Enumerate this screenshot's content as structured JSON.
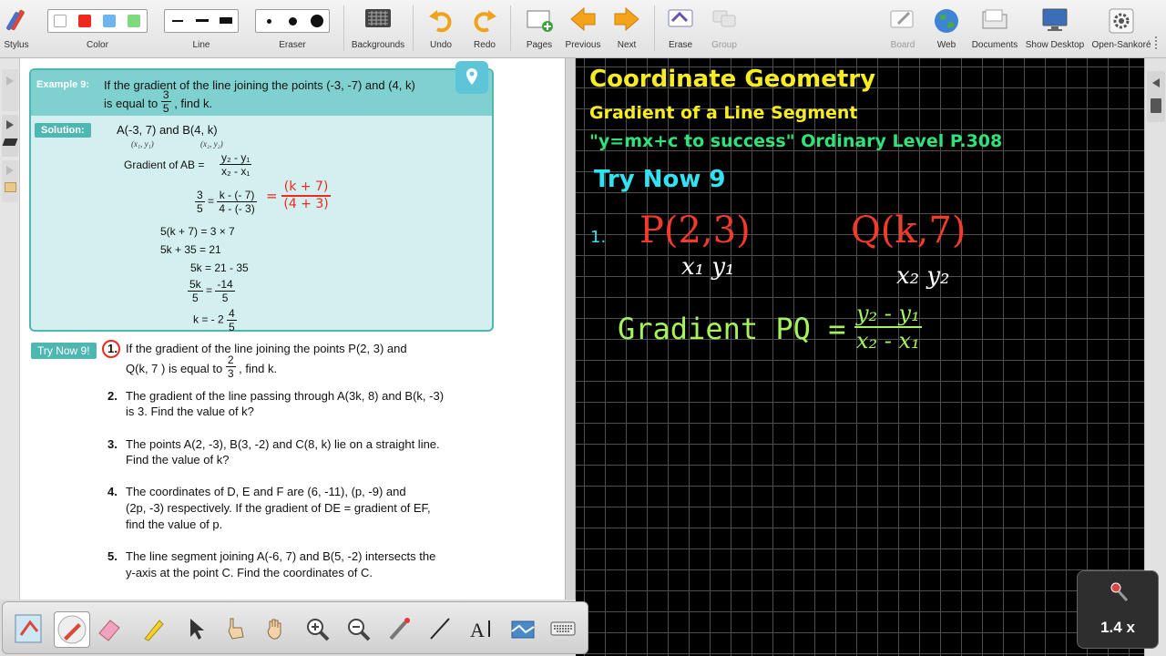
{
  "toolbar": {
    "stylus": "Stylus",
    "color": "Color",
    "line": "Line",
    "eraser": "Eraser",
    "backgrounds": "Backgrounds",
    "undo": "Undo",
    "redo": "Redo",
    "pages": "Pages",
    "previous": "Previous",
    "next": "Next",
    "erase": "Erase",
    "group": "Group",
    "board": "Board",
    "web": "Web",
    "documents": "Documents",
    "show_desktop": "Show Desktop",
    "open_sankore": "Open-Sankoré",
    "swatch_colors": [
      "#ffffff",
      "#ee2a1f",
      "#6fb6ee",
      "#7fd97f"
    ]
  },
  "book": {
    "example_tag": "Example 9:",
    "example_q1": "If the gradient of the line joining the points (-3, -7) and (4, k)",
    "example_q2a": "is equal to",
    "example_frac_n": "3",
    "example_frac_d": "5",
    "example_q2b": ", find k.",
    "solution_tag": "Solution:",
    "points": "A(-3, 7) and B(4, k)",
    "sub1": "(x₁, y₁)",
    "sub2": "(x₂, y₂)",
    "grad_label": "Gradient of AB =",
    "grad_n": "y₂ - y₁",
    "grad_d": "x₂ - x₁",
    "step1_l_n": "3",
    "step1_l_d": "5",
    "step1_eq": "=",
    "step1_r_n": "k - (- 7)",
    "step1_r_d": "4 - (- 3)",
    "step2": "5(k + 7) = 3 × 7",
    "step3": "5k + 35 = 21",
    "step4": "5k = 21 - 35",
    "step5_l_n": "5k",
    "step5_l_d": "5",
    "step5_eq": "=",
    "step5_r_n": "-14",
    "step5_r_d": "5",
    "step6a": "k = - 2",
    "step6_n": "4",
    "step6_d": "5",
    "try_tag": "Try Now 9!",
    "red_eq": "=",
    "red_n": "(k + 7)",
    "red_d": "(4 + 3)",
    "items": [
      {
        "no": "1.",
        "l1": "If the gradient of the line joining the points P(2, 3) and",
        "l2a": "Q(k, 7 ) is equal to",
        "fn": "2",
        "fd": "3",
        "l2b": ", find k."
      },
      {
        "no": "2.",
        "l1": "The gradient of the line passing through A(3k, 8) and B(k, -3)",
        "l2": "is 3.  Find the value of k?"
      },
      {
        "no": "3.",
        "l1": "The points A(2, -3), B(3, -2) and C(8, k) lie on a straight line.",
        "l2": "Find the value of k?"
      },
      {
        "no": "4.",
        "l1": "The coordinates of D, E and F are (6, -11), (p, -9) and",
        "l2": "(2p, -3) respectively.  If the gradient of DE = gradient of EF,",
        "l3": "find the value of p."
      },
      {
        "no": "5.",
        "l1": "The line segment joining A(-6, 7) and B(5, -2) intersects the",
        "l2": "y-axis at the point C.  Find the coordinates of C."
      }
    ]
  },
  "board": {
    "title": "Coordinate Geometry",
    "subtitle": "Gradient of a Line Segment",
    "motto": "\"y=mx+c to success\"  Ordinary Level P.308",
    "try_now": "Try Now 9",
    "ink_num": "1.",
    "ink_p": "P(2,3)",
    "ink_q": "Q(k,7)",
    "ink_x1y1": "x₁ y₁",
    "ink_x2y2": "x₂ y₂",
    "ink_grad": "Gradient PQ =",
    "ink_fn": "y₂ - y₁",
    "ink_fd": "x₂ - x₁",
    "colors": {
      "yellow": "#f7ec22",
      "cyan": "#2fe3f2",
      "green": "#2ee37a",
      "red": "#f23b2b",
      "white": "#ffffff",
      "lime": "#a6f25a"
    }
  },
  "zoom": {
    "value": "1.4 x"
  }
}
